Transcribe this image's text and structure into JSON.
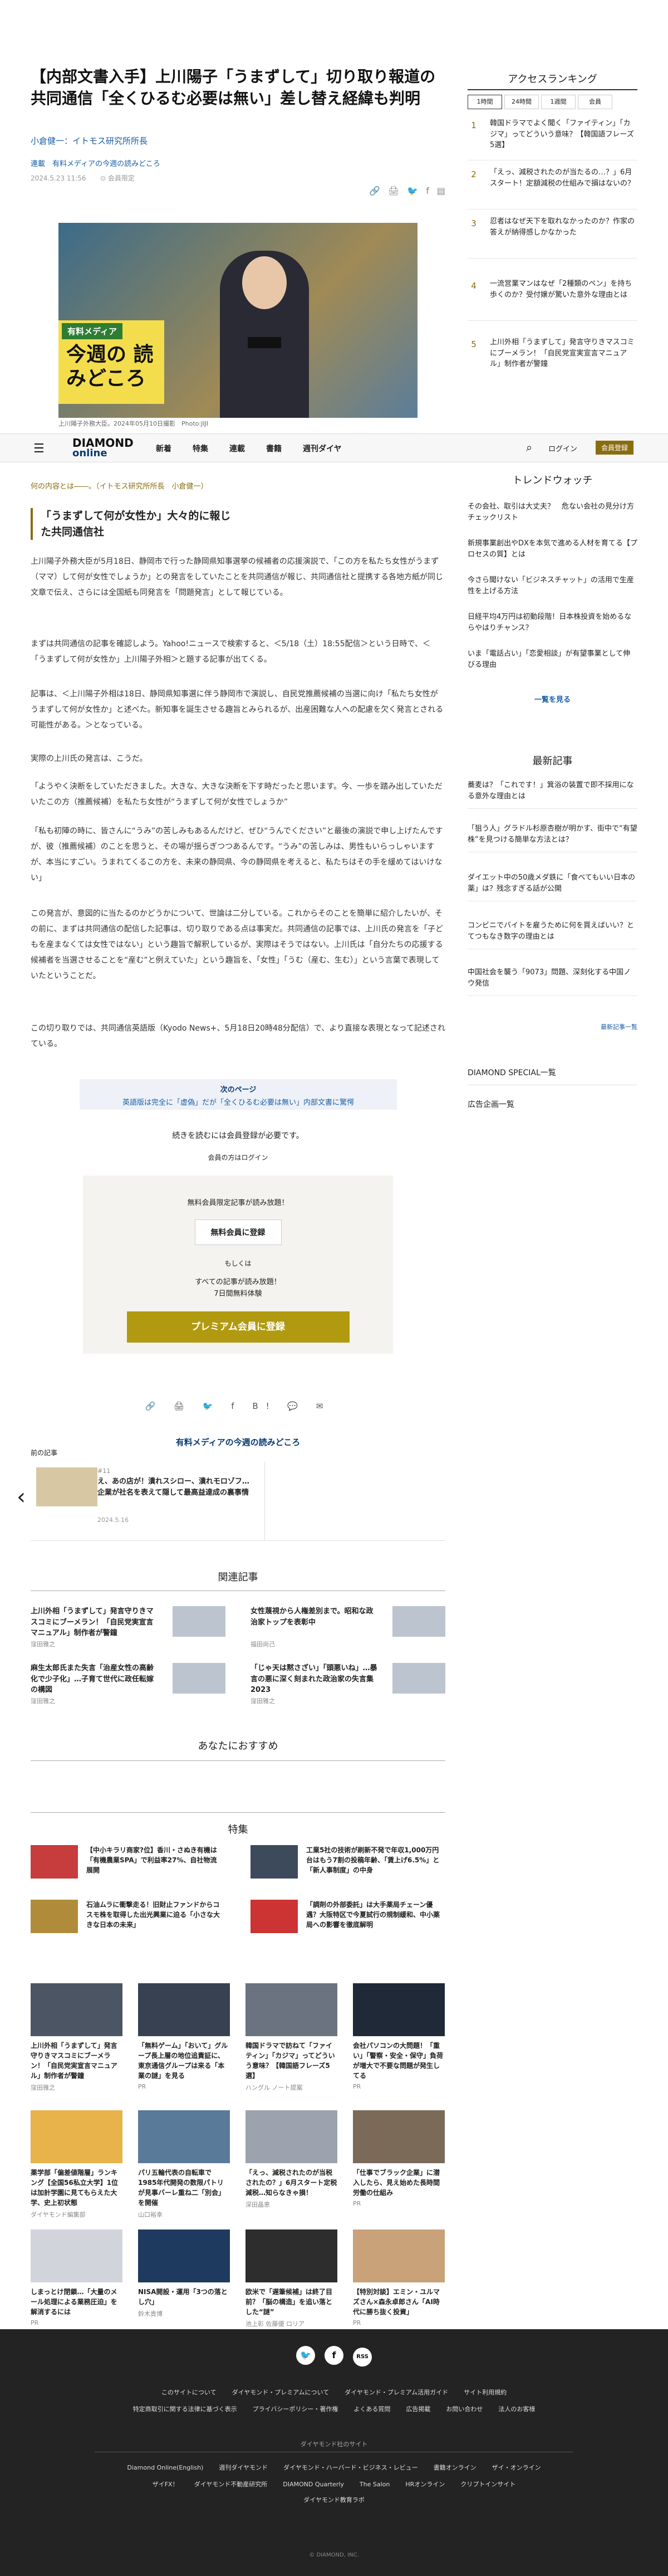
{
  "article": {
    "title": "【内部文書入手】上川陽子「うまずして」切り取り報道の共同通信「全くひるむ必要は無い」差し替え経緯も判明",
    "author": "小倉健一：イトモス研究所所長",
    "series": "連載　有料メディアの今週の読みどころ",
    "date": "2024.5.23 11:56",
    "print": "会員限定",
    "hero_badge_top": "有料メディア",
    "hero_badge_main": "今週の 読みどころ",
    "hero_caption": "上川陽子外務大臣。2024年05月10日撮影　Photo:JIJI",
    "lead_small": "何の内容とは――。（イトモス研究所所長　小倉健一）",
    "subheading": "「うまずして何が女性か」大々的に報じた共同通信社",
    "paragraphs": [
      "上川陽子外務大臣が5月18日、静岡市で行った静岡県知事選挙の候補者の応援演説で、「この方を私たち女性がうまず（ママ）して何が女性でしょうか」との発言をしていたことを共同通信が報じ、共同通信社と提携する各地方紙が同じ文章で伝え、さらには全国紙も同発言を「問題発言」として報じている。",
      "まずは共同通信の記事を確認しよう。Yahoo!ニュースで検索すると、＜5/18（土）18:55配信＞という日時で、＜「うまずして何が女性か」上川陽子外相＞と題する記事が出てくる。",
      "記事は、＜上川陽子外相は18日、静岡県知事選に伴う静岡市で演説し、自民党推薦候補の当選に向け「私たち女性がうまずして何が女性か」と述べた。新知事を誕生させる趣旨とみられるが、出産困難な人への配慮を欠く発言とされる可能性がある。＞となっている。",
      "実際の上川氏の発言は、こうだ。",
      "「ようやく決断をしていただきました。大きな、大きな決断を下す時だったと思います。今、一歩を踏み出していただいたこの方（推薦候補）を私たち女性が“うまずして何が女性でしょうか”",
      "「私も初陣の時に、皆さんに“うみ”の苦しみもあるんだけど、ぜひ“うんでください”と最後の演説で申し上げたんですが、彼（推薦候補）のことを思うと、その場が揺らぎつつあるんです。“うみ”の苦しみは、男性もいらっしゃいますが、本当にすごい。うまれてくるこの方を、未来の静岡県、今の静岡県を考えると、私たちはその手を緩めてはいけない」",
      "この発言が、意図的に当たるのかどうかについて、世論は二分している。これからそのことを簡単に紹介したいが、その前に、まずは共同通信の配信した記事は、切り取りである点は事実だ。共同通信の記事では、上川氏の発言を「子どもを産まなくては女性ではない」という趣旨で解釈しているが、実際はそうではない。上川氏は「自分たちの応援する候補者を当選させることを“産む”と例えていた」という趣旨を、「女性」「うむ（産む、生む）」という言葉で表現していたということだ。",
      "この切り取りでは、共同通信英語版（Kyodo News+、5月18日20時48分配信）で、より直接な表現となって記述されている。"
    ],
    "next_label": "次のページ",
    "next_title": "英語版は完全に「虚偽」だが「全くひるむ必要は無い」内部文書に驚愕",
    "continue_text": "続きを読むには会員登録が必要です。",
    "login_hint": "会員の方はログイン",
    "reg_title": "無料会員限定記事が読み放題！",
    "reg_free_btn": "無料会員に登録",
    "reg_or": "もしくは",
    "reg_all1": "すべての記事が読み放題！",
    "reg_all2": "7日間無料体験",
    "reg_premium_btn": "プレミアム会員に登録",
    "share_icons": "🔗 🖨 🐦 f B! 💬 ✉",
    "series_link": "有料メディアの今週の読みどころ",
    "prev_label": "前の記事",
    "prev_series": "#11",
    "prev_title": "え、あの店が！潰れスシロー、潰れモロゾフ…企業が社名を表えて隠して最高益達成の裏事情",
    "prev_date": "2024.5.16"
  },
  "nav": {
    "logo_top": "DIAMOND",
    "logo_bottom": "online",
    "items": [
      "新着",
      "特集",
      "連載",
      "書籍",
      "週刊ダイヤ"
    ],
    "login": "ログイン",
    "member": "会員登録"
  },
  "related": {
    "heading": "関連記事",
    "items": [
      {
        "title": "上川外相「うまずして」発言守りきマスコミにブーメラン！「自民党実宣言マニュアル」制作者が警鐘",
        "author": "窪田雅之"
      },
      {
        "title": "女性蔑視から人権差別まで。昭和な政治家トップを表彰中",
        "author": "福田尚己"
      },
      {
        "title": "麻生太郎氏また失言「治産女性の高齢化で少子化」…子育て世代に政任転嫁の構図",
        "author": "窪田雅之"
      },
      {
        "title": "「じゃ天は黙さざい」「頭悪いね」…暴言の悪に深く刻まれた政治家の失言集2023",
        "author": "窪田雅之"
      }
    ]
  },
  "recommend": {
    "heading": "あなたにおすすめ"
  },
  "features": {
    "heading": "特集",
    "items": [
      {
        "title": "【中小キラリ商家?位】香川・さぬき有機は「有機農業SPA」で利益率27%、自社物流展開"
      },
      {
        "title": "工業5社の技術が刷新不発で年収1,000万円台はもう7割の投稿年齢、「賃上げ6.5%」と「新人事制度」の中身"
      },
      {
        "title": "石油ムラに衝撃走る！旧財止ファンドからコスモ株を取得した出光興業に迫る「小さな大きな日本の未来」"
      },
      {
        "title": "「調剤の外部委託」は大手薬局チェーン優遇？大阪特区で今夏試行の規制緩和、中小薬局への影響を徹底解明"
      }
    ]
  },
  "cards": [
    {
      "title": "上川外相「うまずして」発言守りきマスコミにブーメラン！「自民党実宣言マニュアル」制作者が警鐘",
      "author": "窪田雅之"
    },
    {
      "title": "「無料ゲーム」「おいて」グループ長上層の地位追責証に、東京通信グループは来る「本業の謎」を見る",
      "author": "PR"
    },
    {
      "title": "韓国ドラマで訪ねて「ファイティン」「カジマ」ってどういう意味？【韓国語フレーズ5選】",
      "author": "ハングル ノート提案"
    },
    {
      "title": "会社パソコンの大問題！「重い」「警察・安全・保守」負荷が増大で不要な問題が発生してる",
      "author": "PR"
    },
    {
      "title": "薬学部「偏差値階層」ランキング【全国56私立大学】1位は加計学園に見てもらえた大学、史上初状態",
      "author": "ダイヤモンド編集部"
    },
    {
      "title": "パリ五輪代表の自転車で1985年代開発の数限パトリが見事バーレ重ね二「別会」を開催",
      "author": "山口裕幸"
    },
    {
      "title": "「えっ、減税されたのが当税されたの？」6月スタート定税減税…知らなきゃ損！",
      "author": "深田晶恵"
    },
    {
      "title": "「仕事でブラック企業」に潜入したら、見え始めた長時間労働の仕組み",
      "author": "PR"
    },
    {
      "title": "しまっとけ閉鎖…「大量のメール処理による業務圧迫」を解消するには",
      "author": "PR"
    },
    {
      "title": "NISA開設・運用「3つの落とし穴」",
      "author": "鈴木貴博"
    },
    {
      "title": "欧米で「遅筆候補」は終了目前？「脳の構造」を追い落とした“謎”",
      "author": "池上彰 佐藤優 ロリア"
    },
    {
      "title": "【特別対談】エミン・ユルマズさん×森永卓郎さん「AI時代に勝ち抜く投資」",
      "author": "PR"
    }
  ],
  "sidebar": {
    "ranking_heading": "アクセスランキング",
    "tabs": [
      "1時間",
      "24時間",
      "1週間",
      "会員"
    ],
    "ranking": [
      "韓国ドラマでよく聞く「ファイティン」「カジマ」ってどういう意味？【韓国語フレーズ5選】",
      "「えっ、減税されたのが当たるの…？」6月スタート！定額減税の仕組みで損はないの？",
      "忍者はなぜ天下を取れなかったのか？作家の答えが納得感しかなかった",
      "一流営業マンはなぜ「2種類のペン」を持ち歩くのか？受付嬢が驚いた意外な理由とは",
      "上川外相「うまずして」発言守りきマスコミにブーメラン！「自民党宣実宣言マニュアル」制作者が警鐘"
    ],
    "trend_heading": "トレンドウォッチ",
    "trends": [
      "その会社、取引は大丈夫？　危ない会社の見分け方チェックリスト",
      "新規事業創出やDXを本気で進める人材を育てる【プロセスの質】とは",
      "今さら聞けない「ビジネスチャット」の活用で生産性を上げる方法",
      "日経平均4万円は初動段階！日本株投資を始めるならやはりチャンス？",
      "いま「電話占い」「恋愛相談」が有望事業として伸びる理由"
    ],
    "trend_more": "一覧を見る",
    "latest_heading": "最新記事",
    "latest": [
      "蕎麦は？「これです！」箕浴の装置で即不採用になる意外な理由とは",
      "「狙う人」グラドル杉原杏樹が明かす、街中で“有望株”を見つける簡単な方法とは？",
      "ダイエット中の50歳メダ鉄に「食べてもいい日本の薬」は？残念すぎる話が公開",
      "コンビニでバイトを雇うために何を買えばいい？とてつもなき数字の理由とは",
      "中国社会を襲う「9073」問題、深刻化する中国ノウ発信"
    ],
    "latest_more": "最新記事一覧",
    "special": "DIAMOND SPECIAL一覧",
    "ads": "広告企画一覧"
  },
  "footer": {
    "social": [
      "🐦",
      "f",
      "RSS"
    ],
    "row1": [
      "このサイトについて",
      "ダイヤモンド・プレミアムについて",
      "ダイヤモンド・プレミアム活用ガイド",
      "サイト利用規約"
    ],
    "row2": [
      "特定商取引に関する法律に基づく表示",
      "プライバシーポリシー・著作権",
      "よくある質問",
      "広告掲載",
      "お問い合わせ",
      "法人のお客様"
    ],
    "group": "ダイヤモンド社のサイト",
    "row3": [
      "Diamond Online(English)",
      "週刊ダイヤモンド",
      "ダイヤモンド・ハーバード・ビジネス・レビュー",
      "書籍オンライン",
      "ザイ・オンライン"
    ],
    "row4": [
      "ザイFX！",
      "ダイヤモンド不動産研究所",
      "DIAMOND Quarterly",
      "The Salon",
      "HRオンライン",
      "クリプトインサイト"
    ],
    "row5": [
      "ダイヤモンド教育ラボ"
    ],
    "copyright": "© DIAMOND, INC."
  },
  "colors": {
    "gold": "#8a6d11",
    "navy": "#0a3a72",
    "premium": "#b19a10"
  }
}
